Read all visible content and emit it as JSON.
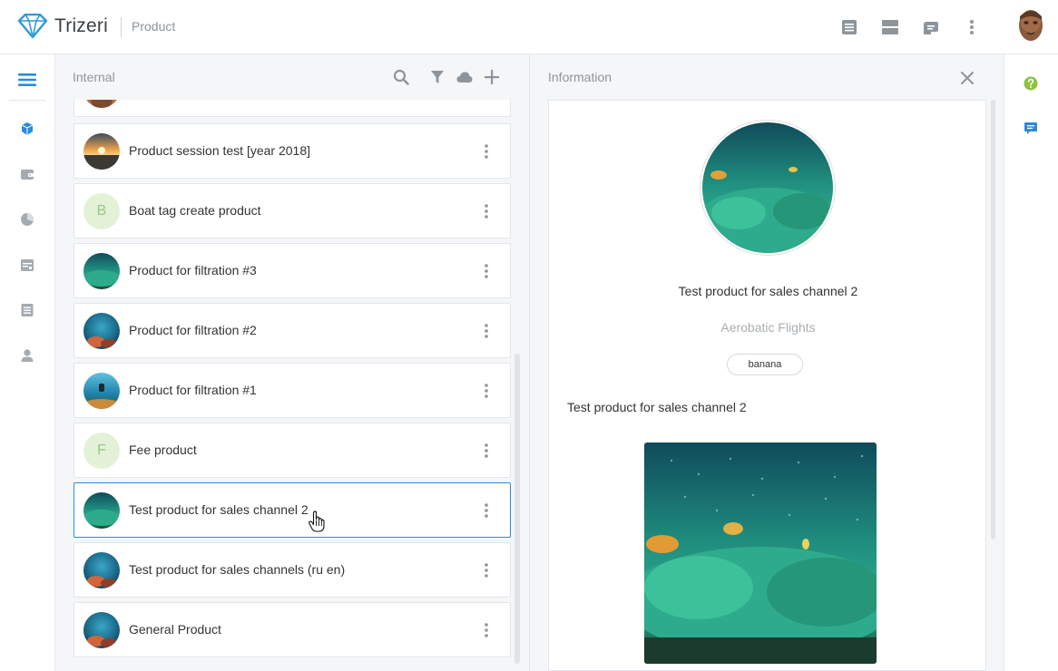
{
  "app": {
    "name": "Trizeri",
    "section": "Product"
  },
  "colors": {
    "accent": "#2b8bd9",
    "logo": "#2f9ad8",
    "icon_gray": "#8d959c",
    "help_green": "#8cc23e",
    "chat_blue": "#2b8bd9"
  },
  "topbar": {
    "icons": [
      "list-view-icon",
      "table-view-icon",
      "export-icon",
      "more-vertical-icon"
    ],
    "avatar": "user-avatar"
  },
  "leftnav": {
    "items": [
      "menu-icon",
      "products-cube-icon",
      "wallet-icon",
      "chart-icon",
      "calendar-icon",
      "document-icon",
      "user-icon"
    ]
  },
  "list": {
    "title": "Internal",
    "tools": [
      "search-icon",
      "filter-icon",
      "cloud-icon",
      "add-icon"
    ],
    "items": [
      {
        "name": "",
        "thumb": "reef"
      },
      {
        "name": "Product session test [year 2018]",
        "thumb": "sunset"
      },
      {
        "name": "Boat tag create product",
        "letter": "B"
      },
      {
        "name": "Product for filtration #3",
        "thumb": "anemone"
      },
      {
        "name": "Product for filtration #2",
        "thumb": "reef"
      },
      {
        "name": "Product for filtration #1",
        "thumb": "diver"
      },
      {
        "name": "Fee product",
        "letter": "F"
      },
      {
        "name": "Test product for sales channel 2",
        "thumb": "anemone",
        "selected": true
      },
      {
        "name": "Test product for sales channels (ru en)",
        "thumb": "reef"
      },
      {
        "name": "General Product",
        "thumb": "reef"
      }
    ]
  },
  "info": {
    "title": "Information",
    "name": "Test product for sales channel 2",
    "category": "Aerobatic Flights",
    "tag": "banana",
    "description": "Test product for sales channel 2"
  },
  "rail": {
    "items": [
      "help-icon",
      "chat-icon"
    ]
  }
}
